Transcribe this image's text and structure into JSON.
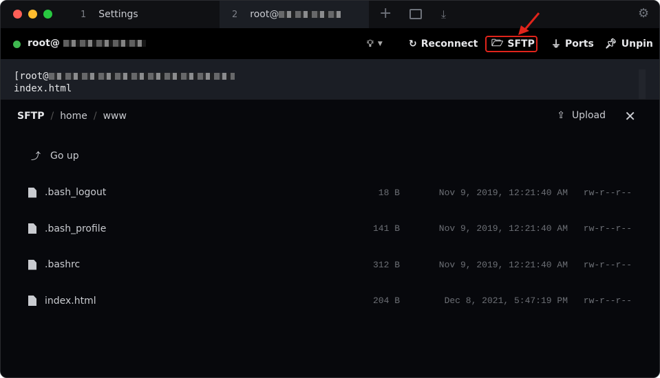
{
  "window": {
    "traffic_lights": [
      "#fe5f57",
      "#febc2e",
      "#28c840"
    ]
  },
  "tabs": [
    {
      "number": "1",
      "label": "Settings",
      "active": false
    },
    {
      "number": "2",
      "label": "root@",
      "active": true
    }
  ],
  "toolbar": {
    "host": "root@",
    "status_color": "#3fb950",
    "reconnect": "Reconnect",
    "sftp": "SFTP",
    "ports": "Ports",
    "unpin": "Unpin",
    "highlight_color": "#e0241b"
  },
  "terminal": {
    "lines": [
      "[root@",
      "index.html"
    ]
  },
  "sftp": {
    "breadcrumb": [
      "SFTP",
      "home",
      "www"
    ],
    "upload": "Upload",
    "go_up": "Go up",
    "files": [
      {
        "name": ".bash_logout",
        "size": "18 B",
        "modified": "Nov 9, 2019, 12:21:40 AM",
        "perms": "rw-r--r--"
      },
      {
        "name": ".bash_profile",
        "size": "141 B",
        "modified": "Nov 9, 2019, 12:21:40 AM",
        "perms": "rw-r--r--"
      },
      {
        "name": ".bashrc",
        "size": "312 B",
        "modified": "Nov 9, 2019, 12:21:40 AM",
        "perms": "rw-r--r--"
      },
      {
        "name": "index.html",
        "size": "204 B",
        "modified": "Dec 8, 2021, 5:47:19 PM",
        "perms": "rw-r--r--"
      }
    ]
  }
}
